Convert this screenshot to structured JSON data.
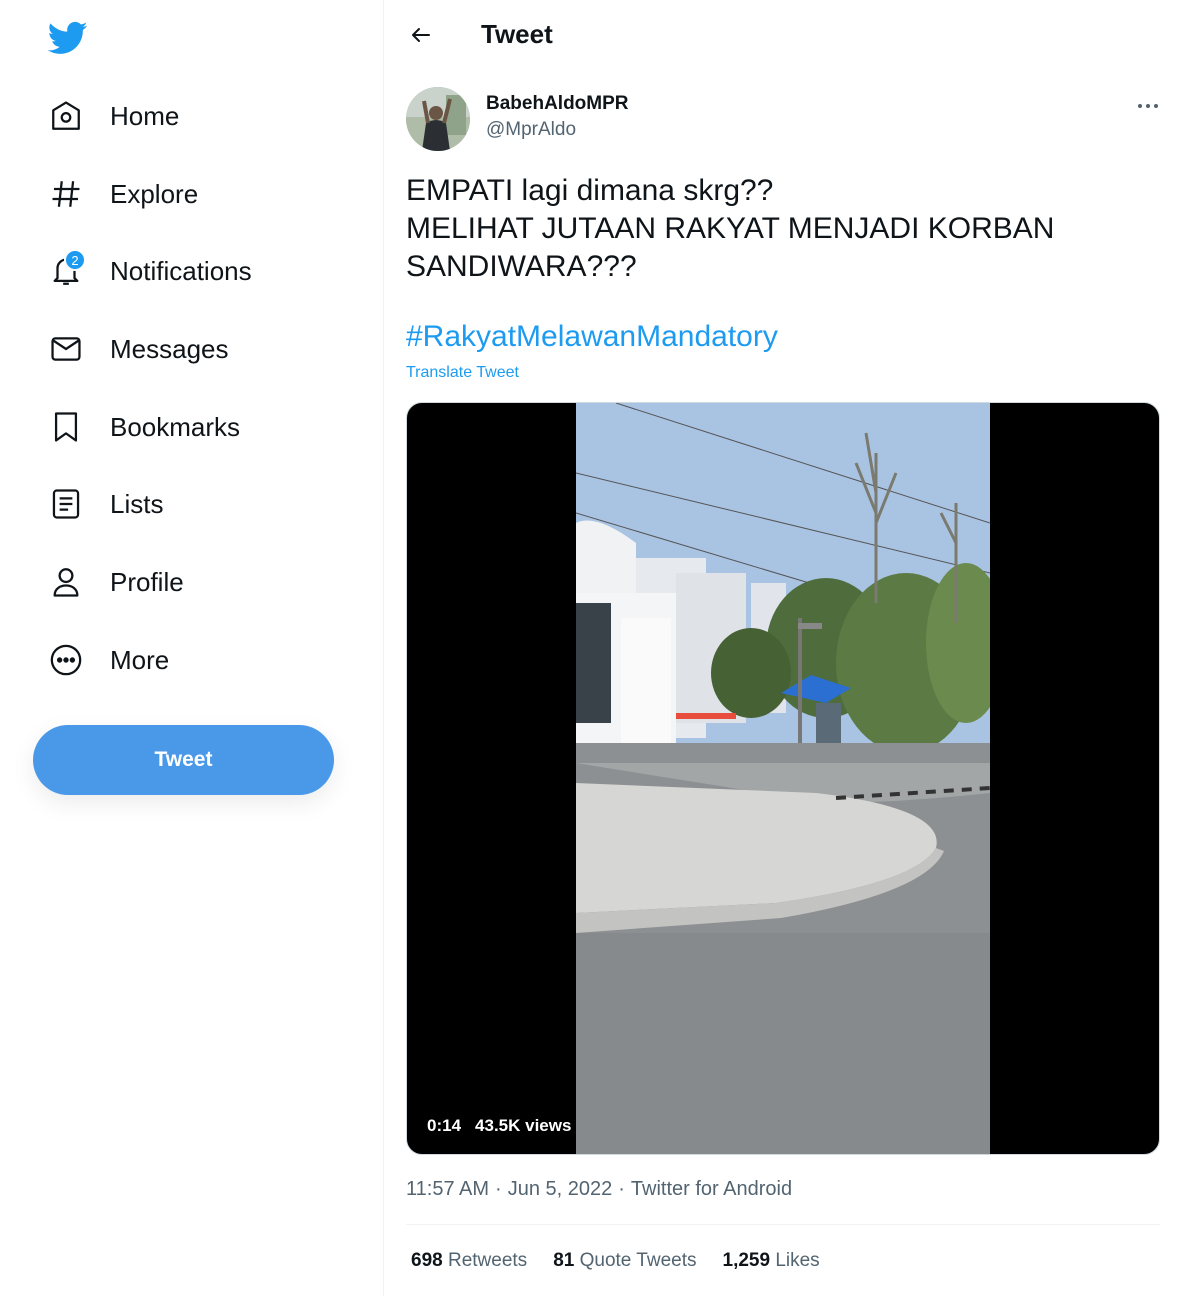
{
  "sidebar": {
    "logo": "twitter-bird-icon",
    "items": [
      {
        "label": "Home",
        "icon": "home-icon"
      },
      {
        "label": "Explore",
        "icon": "hashtag-icon"
      },
      {
        "label": "Notifications",
        "icon": "bell-icon",
        "badge": "2"
      },
      {
        "label": "Messages",
        "icon": "envelope-icon"
      },
      {
        "label": "Bookmarks",
        "icon": "bookmark-icon"
      },
      {
        "label": "Lists",
        "icon": "list-icon"
      },
      {
        "label": "Profile",
        "icon": "person-icon"
      },
      {
        "label": "More",
        "icon": "more-circle-icon"
      }
    ],
    "tweet_button": "Tweet"
  },
  "header": {
    "title": "Tweet"
  },
  "tweet": {
    "display_name": "BabehAldoMPR",
    "handle": "@MprAldo",
    "text_lines": [
      "EMPATI lagi dimana skrg??",
      "MELIHAT JUTAAN RAKYAT MENJADI KORBAN",
      "SANDIWARA???"
    ],
    "hashtag": "#RakyatMelawanMandatory",
    "translate": "Translate Tweet",
    "video": {
      "duration": "0:14",
      "views": "43.5K views"
    },
    "time": "11:57 AM",
    "date": "Jun 5, 2022",
    "source": "Twitter for Android",
    "separator": "·",
    "stats": {
      "retweets_count": "698",
      "retweets_label": "Retweets",
      "quotes_count": "81",
      "quotes_label": "Quote Tweets",
      "likes_count": "1,259",
      "likes_label": "Likes"
    }
  },
  "colors": {
    "accent": "#1d9bf0",
    "tweet_button": "#4a99e9",
    "text": "#0f1419",
    "secondary": "#536471"
  }
}
